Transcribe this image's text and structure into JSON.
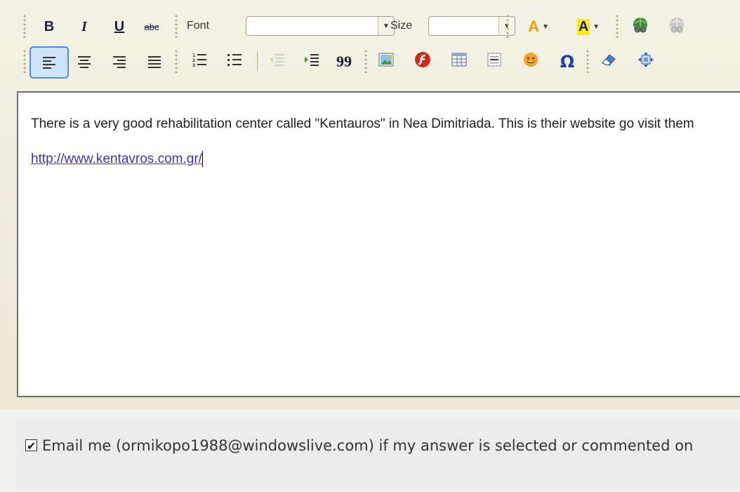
{
  "toolbar": {
    "row1": {
      "bold": "B",
      "italic": "I",
      "underline": "U",
      "strikethrough": "abc",
      "font_label": "Font",
      "font_value": "",
      "size_label": "Size",
      "size_value": "",
      "text_color": "A",
      "bg_color": "A",
      "icons": [
        "bold-icon",
        "italic-icon",
        "underline-icon",
        "strikethrough-icon",
        "text-color-icon",
        "background-color-icon",
        "link-icon",
        "unlink-icon"
      ]
    },
    "row2": {
      "icons": [
        "align-left-icon",
        "align-center-icon",
        "align-right-icon",
        "align-justify-icon",
        "numbered-list-icon",
        "bulleted-list-icon",
        "outdent-icon",
        "indent-icon",
        "blockquote-icon",
        "image-icon",
        "flash-icon",
        "table-icon",
        "horizontal-rule-icon",
        "smiley-icon",
        "special-char-icon",
        "remove-format-icon",
        "maximize-icon"
      ],
      "quote_glyph": "99",
      "omega_glyph": "Ω"
    }
  },
  "content": {
    "paragraph": "There is a very good rehabilitation center called \"Kentauros\" in Nea Dimitriada. This is their website go visit them",
    "link_text": "http://www.kentavros.com.gr/"
  },
  "email_option": {
    "checked": true,
    "label": "Email me (ormikopo1988@windowslive.com) if my answer is selected or commented on"
  },
  "colors": {
    "toolbar_bg": "#efeddf",
    "active_button_border": "#4c8de0",
    "link_color": "#4b2ea6",
    "highlight_yellow": "#ffee00"
  }
}
